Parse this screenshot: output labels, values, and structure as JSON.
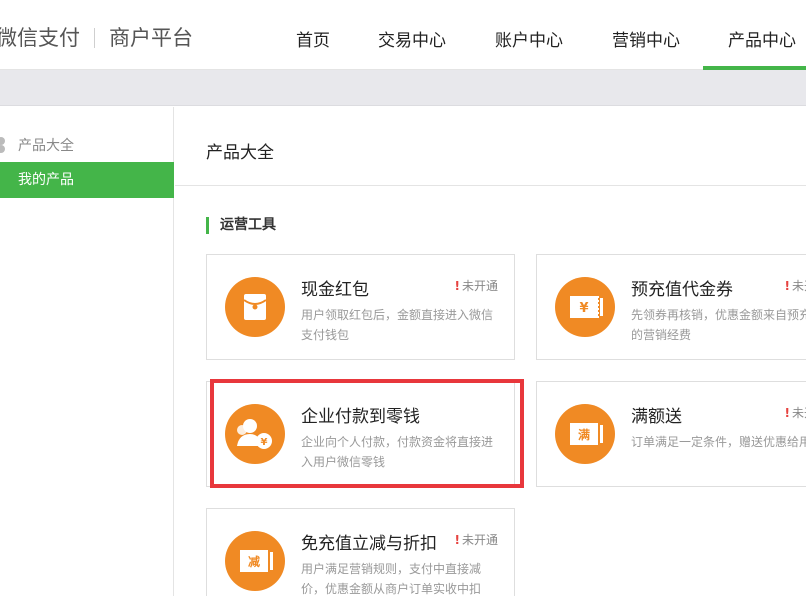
{
  "header": {
    "brand": "微信支付",
    "brand_sub": "商户平台",
    "nav": [
      "首页",
      "交易中心",
      "账户中心",
      "营销中心",
      "产品中心"
    ],
    "active_nav": "产品中心"
  },
  "sidebar": {
    "heading": "产品大全",
    "items": [
      {
        "label": "我的产品",
        "active": true
      }
    ]
  },
  "main": {
    "title": "产品大全",
    "section": "运营工具",
    "cards": [
      {
        "title": "现金红包",
        "badge": "未开通",
        "desc": "用户领取红包后，金额直接进入微信支付钱包",
        "icon": "red-envelope-icon"
      },
      {
        "title": "预充值代金券",
        "badge": "未开通",
        "desc": "先领券再核销，优惠金额来自预充值的营销经费",
        "icon": "yen-voucher-icon"
      },
      {
        "title": "企业付款到零钱",
        "badge": "",
        "desc": "企业向个人付款，付款资金将直接进入用户微信零钱",
        "icon": "enterprise-payment-icon"
      },
      {
        "title": "满额送",
        "badge": "未开通",
        "desc": "订单满足一定条件，赠送优惠给用户",
        "icon": "full-gift-icon",
        "icon_text": "满"
      },
      {
        "title": "免充值立减与折扣",
        "badge": "未开通",
        "desc": "用户满足营销规则，支付中直接减价，优惠金额从商户订单实收中扣",
        "icon": "instant-discount-icon",
        "icon_text": "减"
      }
    ]
  },
  "colors": {
    "accent": "#44b549",
    "icon_orange": "#f08a24",
    "highlight": "#e8373c",
    "warning": "#e64340"
  }
}
